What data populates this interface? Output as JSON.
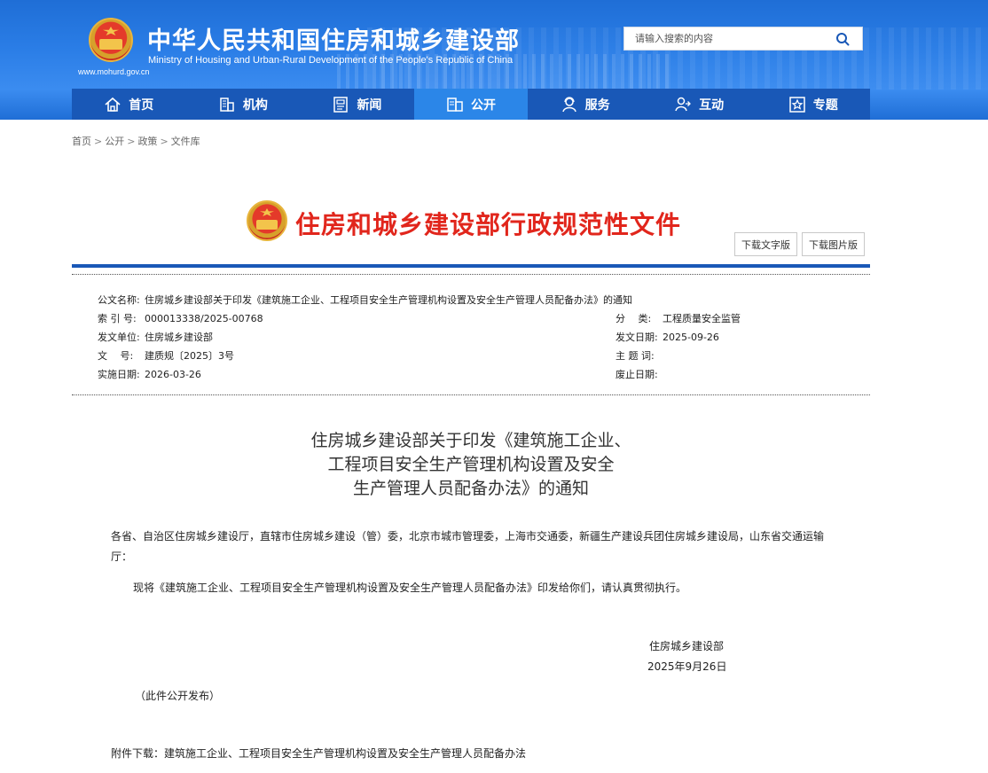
{
  "header": {
    "title_cn": "中华人民共和国住房和城乡建设部",
    "title_en": "Ministry of Housing and Urban-Rural Development of the People's Republic of China",
    "site_url": "www.mohurd.gov.cn",
    "search_placeholder": "请输入搜索的内容"
  },
  "nav": {
    "items": [
      {
        "label": "首页",
        "icon": "home-icon"
      },
      {
        "label": "机构",
        "icon": "building-icon"
      },
      {
        "label": "新闻",
        "icon": "news-icon"
      },
      {
        "label": "公开",
        "icon": "public-icon",
        "active": true
      },
      {
        "label": "服务",
        "icon": "service-icon"
      },
      {
        "label": "互动",
        "icon": "interact-icon"
      },
      {
        "label": "专题",
        "icon": "star-icon"
      }
    ]
  },
  "breadcrumb": [
    "首页",
    "公开",
    "政策",
    "文件库"
  ],
  "doc_banner": {
    "title": "住房和城乡建设部行政规范性文件",
    "download_text": "下载文字版",
    "download_image": "下载图片版"
  },
  "meta": {
    "name_key": "公文名称:",
    "name_val": "住房城乡建设部关于印发《建筑施工企业、工程项目安全生产管理机构设置及安全生产管理人员配备办法》的通知",
    "index_key": "索 引 号:",
    "index_val": "000013338/2025-00768",
    "category_key": "分　 类:",
    "category_val": "工程质量安全监管",
    "issuer_key": "发文单位:",
    "issuer_val": "住房城乡建设部",
    "date_key": "发文日期:",
    "date_val": "2025-09-26",
    "docno_key": "文　 号:",
    "docno_val": "建质规〔2025〕3号",
    "subject_key": "主 题 词:",
    "subject_val": "",
    "effective_key": "实施日期:",
    "effective_val": "2026-03-26",
    "expire_key": "废止日期:",
    "expire_val": ""
  },
  "article": {
    "title_line1": "住房城乡建设部关于印发《建筑施工企业、",
    "title_line2": "工程项目安全生产管理机构设置及安全",
    "title_line3": "生产管理人员配备办法》的通知",
    "recipients_line1": "各省、自治区住房城乡建设厅，直辖市住房城乡建设（管）委，北京市城市管理委，上海市交通委，新疆生产建设兵团住房城乡建设局，山东省交通运输",
    "recipients_line2": "厅：",
    "body": "现将《建筑施工企业、工程项目安全生产管理机构设置及安全生产管理人员配备办法》印发给你们，请认真贯彻执行。",
    "signer": "住房城乡建设部",
    "sign_date": "2025年9月26日",
    "public_note": "（此件公开发布）",
    "attachment_label": "附件下载：",
    "attachment_link": "建筑施工企业、工程项目安全生产管理机构设置及安全生产管理人员配备办法"
  }
}
